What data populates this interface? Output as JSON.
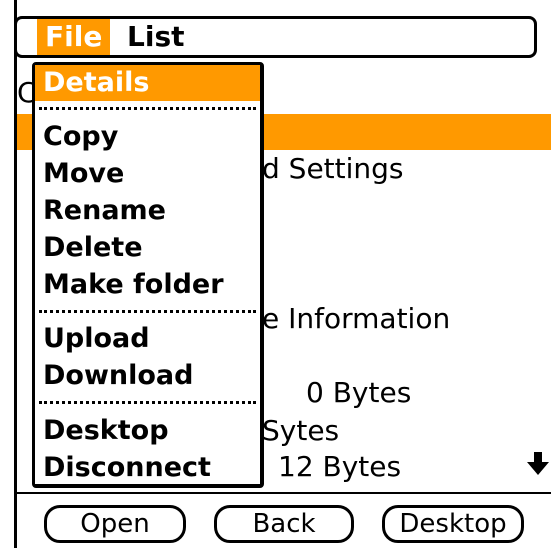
{
  "menubar": {
    "file_label": "File",
    "list_label": "List"
  },
  "menu": {
    "items": [
      "Details",
      "Copy",
      "Move",
      "Rename",
      "Delete",
      "Make folder",
      "Upload",
      "Download",
      "Desktop",
      "Disconnect"
    ]
  },
  "background": {
    "stray_char": "C",
    "row1": "d Settings",
    "row2": "e Information",
    "row3": "0 Bytes",
    "row4": "Sytes",
    "row5": "12 Bytes"
  },
  "buttons": {
    "open": "Open",
    "back": "Back",
    "desktop": "Desktop"
  },
  "colors": {
    "accent": "#ff9900"
  },
  "icons": {
    "scroll": "arrow-down-icon"
  }
}
